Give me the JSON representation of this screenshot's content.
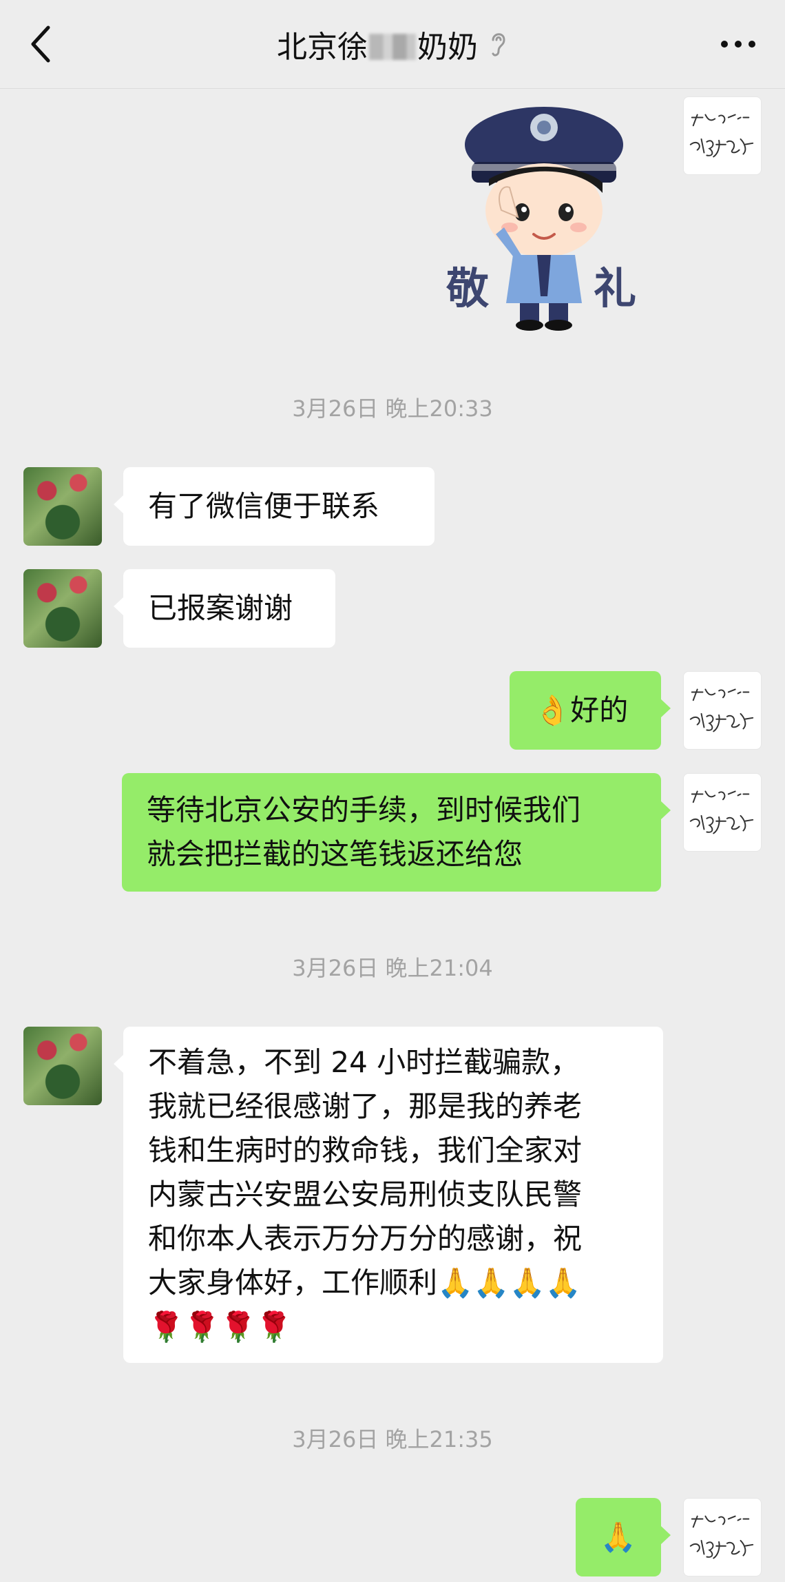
{
  "header": {
    "title_prefix": "北京徐",
    "title_suffix": "奶奶"
  },
  "icons": {
    "back": "chevron-left-icon",
    "ear": "ear-icon",
    "more": "more-dots-icon"
  },
  "sticker": {
    "left_char": "敬",
    "right_char": "礼"
  },
  "messages": {
    "t1": "3月26日 晚上20:33",
    "m1": "有了微信便于联系",
    "m2": "已报案谢谢",
    "m3_emoji": "👌",
    "m3": "好的",
    "m4_line1": "等待北京公安的手续，到时候我们",
    "m4_line2": "就会把拦截的这笔钱返还给您",
    "t2": "3月26日 晚上21:04",
    "m5_line1": "不着急，不到 24 小时拦截骗款，",
    "m5_line2": "我就已经很感谢了，那是我的养老",
    "m5_line3": "钱和生病时的救命钱，我们全家对",
    "m5_line4": "内蒙古兴安盟公安局刑侦支队民警",
    "m5_line5": "和你本人表示万分万分的感谢，祝",
    "m5_line6": "大家身体好，工作顺利🙏🙏🙏🙏",
    "m5_line7": "🌹🌹🌹🌹",
    "t3": "3月26日 晚上21:35",
    "m6": "🙏"
  },
  "colors": {
    "bg": "#ededed",
    "my_bubble": "#95ec69",
    "their_bubble": "#ffffff",
    "timestamp": "#a3a3a3"
  }
}
